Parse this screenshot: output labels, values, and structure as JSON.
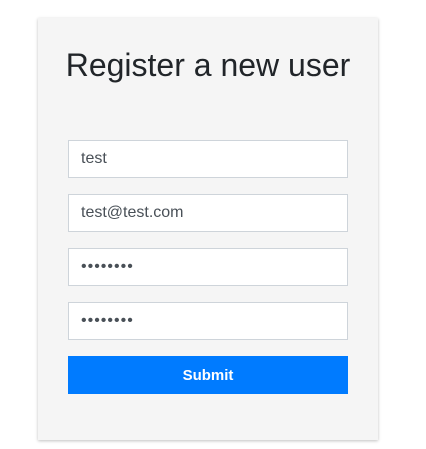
{
  "form": {
    "title": "Register a new user",
    "username_value": "test",
    "email_value": "test@test.com",
    "password_value": "password",
    "confirm_password_value": "password",
    "submit_label": "Submit",
    "accent_color": "#007bff"
  }
}
